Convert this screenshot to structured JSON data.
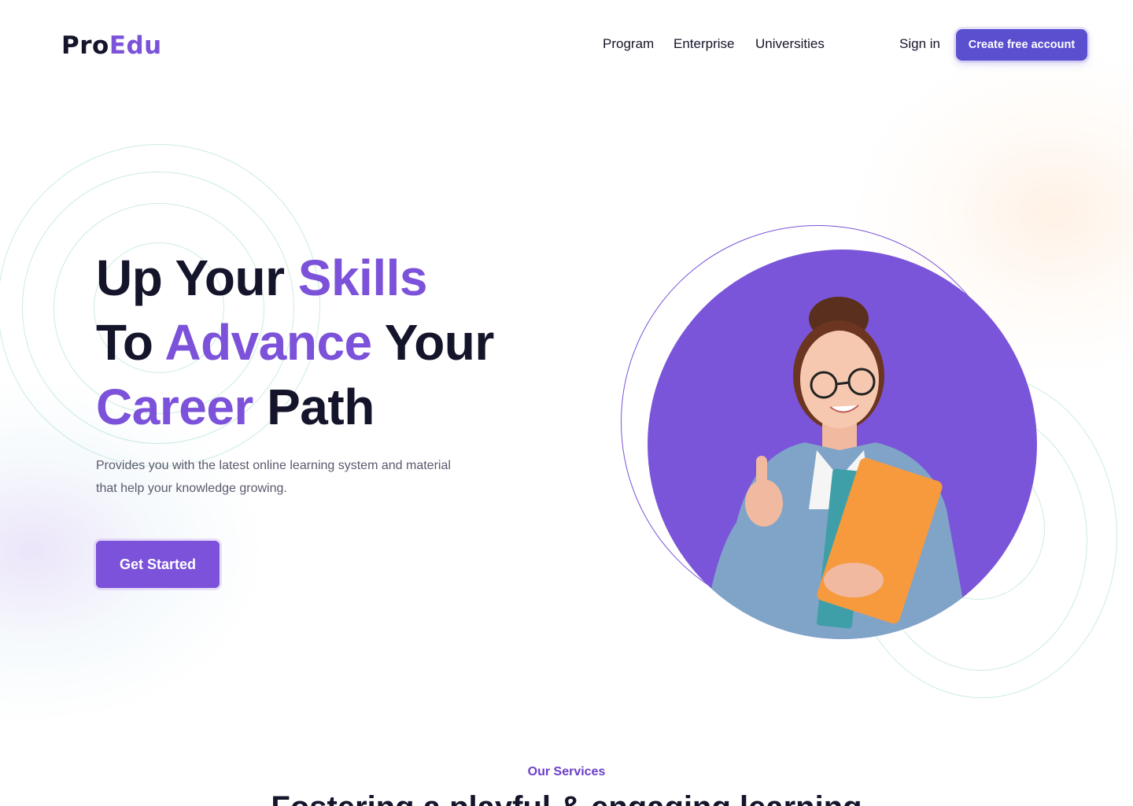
{
  "brand": {
    "name_part1": "Pro",
    "name_part2": "Edu"
  },
  "nav": {
    "links": [
      "Program",
      "Enterprise",
      "Universities"
    ],
    "sign_in": "Sign in",
    "cta": "Create free account"
  },
  "hero": {
    "headline": {
      "line1_a": "Up Your ",
      "line1_b": "Skills",
      "line2_a": "To ",
      "line2_b": "Advance",
      "line2_c": " Your",
      "line3_a": "Career",
      "line3_b": " Path"
    },
    "subtitle_line1": "Provides you with the latest online learning system and material",
    "subtitle_line2": "that help your knowledge growing.",
    "button": "Get Started",
    "image_alt": "student-holding-folders-thumbs-up"
  },
  "services": {
    "kicker": "Our Services",
    "title": "Fostering a playful & engaging learning"
  },
  "colors": {
    "accent": "#7b52d9",
    "cta": "#5a4fcf",
    "text_dark": "#14142b",
    "text_muted": "#5a5a6e"
  }
}
